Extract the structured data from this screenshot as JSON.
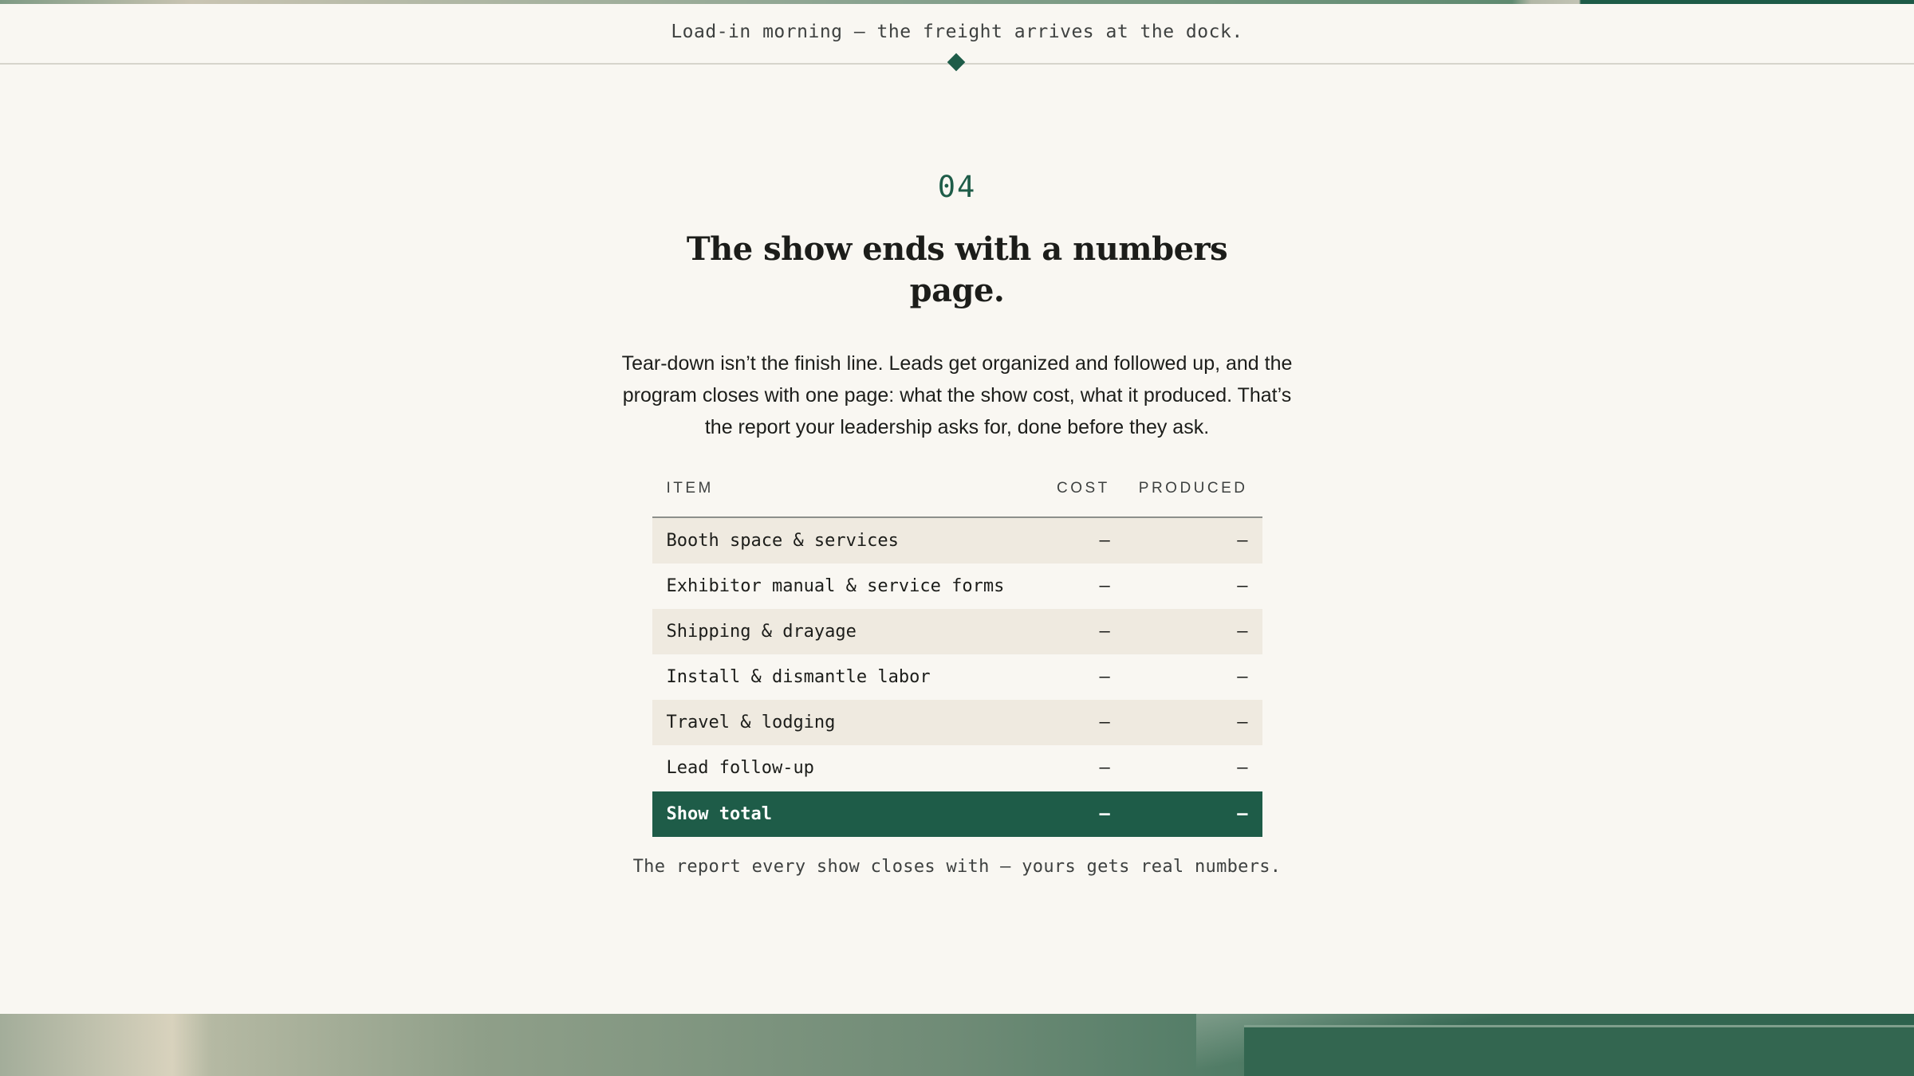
{
  "caption": "Load-in morning — the freight arrives at the dock.",
  "section": {
    "number": "04",
    "heading": "The show ends with a numbers page.",
    "intro": "Tear-down isn’t the finish line. Leads get organized and followed up, and the program closes with one page: what the show cost, what it produced. That’s the report your leadership asks for, done before they ask."
  },
  "table": {
    "headers": {
      "item": "ITEM",
      "cost": "COST",
      "produced": "PRODUCED"
    },
    "rows": [
      {
        "item": "Booth space & services",
        "cost": "—",
        "produced": "—"
      },
      {
        "item": "Exhibitor manual & service forms",
        "cost": "—",
        "produced": "—"
      },
      {
        "item": "Shipping & drayage",
        "cost": "—",
        "produced": "—"
      },
      {
        "item": "Install & dismantle labor",
        "cost": "—",
        "produced": "—"
      },
      {
        "item": "Travel & lodging",
        "cost": "—",
        "produced": "—"
      },
      {
        "item": "Lead follow-up",
        "cost": "—",
        "produced": "—"
      }
    ],
    "total": {
      "item": "Show total",
      "cost": "—",
      "produced": "—"
    }
  },
  "footnote": "The report every show closes with — yours gets real numbers.",
  "colors": {
    "accent": "#1e5c48",
    "background": "#f9f7f2",
    "row_shade": "#efeae0"
  }
}
